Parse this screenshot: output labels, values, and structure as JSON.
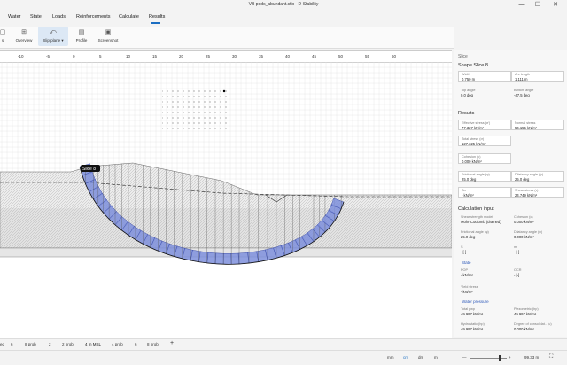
{
  "window": {
    "title": "VB pods_abundant.stix - D-Stability",
    "min": "—",
    "max": "☐",
    "close": "✕"
  },
  "menu": [
    "Water",
    "State",
    "Loads",
    "Reinforcements",
    "Calculate",
    "Results"
  ],
  "active_menu": "Results",
  "ribbon": [
    {
      "label": "s",
      "icon": "▢"
    },
    {
      "label": "Overview",
      "icon": "⊞"
    },
    {
      "label": "Slip plane",
      "icon": "⤺"
    },
    {
      "label": "Profile",
      "icon": "▤"
    },
    {
      "label": "Screenshot",
      "icon": "▣"
    }
  ],
  "ruler_ticks": [
    "-10",
    "-5",
    "0",
    "5",
    "10",
    "15",
    "20",
    "25",
    "30",
    "35",
    "40",
    "45",
    "50",
    "55",
    "60"
  ],
  "slice_label": "Slice 8",
  "panel": {
    "header": "Slice",
    "shape_title": "Shape Slice 8",
    "shape": [
      {
        "l": "Width",
        "v": "0.750 m"
      },
      {
        "l": "Arc length",
        "v": "1.111 m"
      },
      {
        "l": "Top angle",
        "v": "0.0 deg"
      },
      {
        "l": "Bottom angle",
        "v": "-47.5 deg"
      }
    ],
    "results_title": "Results",
    "results": [
      {
        "l": "Effective stress (σ')",
        "v": "77.327 kN/m²"
      },
      {
        "l": "Normal stress",
        "v": "54.155 kN/m²"
      },
      {
        "l": "Total stress (σ)",
        "v": "127.325 kN/m²"
      },
      {
        "l": "",
        "v": ""
      },
      {
        "l": "Cohesion (c)",
        "v": "0.000 kN/m²"
      },
      {
        "l": "",
        "v": ""
      },
      {
        "l": "Frictional angle (φ)",
        "v": "25.0 deg"
      },
      {
        "l": "Dilatancy angle (ψ)",
        "v": "25.0 deg"
      },
      {
        "l": "Su",
        "v": "- kN/m²"
      },
      {
        "l": "Shear stress (τ)",
        "v": "24.749 kN/m²"
      }
    ],
    "calc_title": "Calculation input",
    "calc": [
      {
        "l": "Shear strength model",
        "v": "Mohr-Coulomb (drained)"
      },
      {
        "l": "Cohesion (c)",
        "v": "0.000 kN/m²"
      },
      {
        "l": "Frictional angle (φ)",
        "v": "25.0 deg"
      },
      {
        "l": "Dilatancy angle (ψ)",
        "v": "0.000 kN/m²"
      },
      {
        "l": "S",
        "v": "- [-]"
      },
      {
        "l": "m",
        "v": "- [-]"
      }
    ],
    "state_title": "State",
    "state": [
      {
        "l": "POP",
        "v": "- kN/m²"
      },
      {
        "l": "OCR",
        "v": "- [-]"
      }
    ],
    "yield_label": "Yield stress",
    "yield_value": "- kN/m²",
    "water_title": "Water pressure",
    "water": [
      {
        "l": "Total pwp",
        "v": "49.997 kN/m²"
      },
      {
        "l": "Piezometric (hp)",
        "v": "49.997 kN/m²"
      },
      {
        "l": "Hydrostatic (hp)",
        "v": "49.997 kN/m²"
      },
      {
        "l": "Degree of consolidat.. (u)",
        "v": "0.000 kN/m²"
      }
    ]
  },
  "tabs": [
    "ed",
    "6",
    "8 prob",
    "2",
    "2 prob",
    "4 m MSL",
    "4 prob",
    "6",
    "8 prob"
  ],
  "status": {
    "units": [
      "mm",
      "cm",
      "dm",
      "m"
    ],
    "zoom": "99.33 m",
    "minus": "—",
    "plus": "+"
  },
  "colors": {
    "slice_fill": "#7e8fdc",
    "slice_stroke": "#2b3c9c",
    "accent": "#1b6ec2"
  }
}
